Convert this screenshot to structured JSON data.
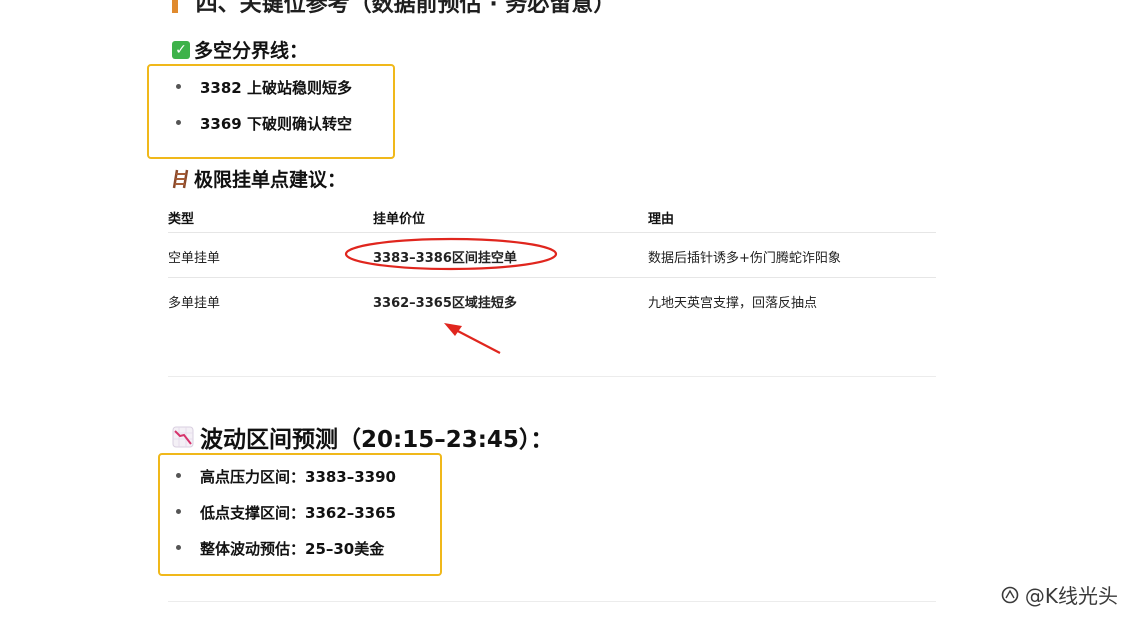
{
  "top_heading": "四、关键位参考（数据前预估 · 务必留意）",
  "section1": {
    "title": "多空分界线：",
    "items": [
      "3382 上破站稳则短多",
      "3369 下破则确认转空"
    ]
  },
  "section2": {
    "title": "极限挂单点建议：",
    "headers": [
      "类型",
      "挂单价位",
      "理由"
    ],
    "rows": [
      {
        "type": "空单挂单",
        "price": "3383–3386区间挂空单",
        "reason": "数据后插针诱多+伤门腾蛇诈阳象"
      },
      {
        "type": "多单挂单",
        "price": "3362–3365区域挂短多",
        "reason": "九地天英宫支撑，回落反抽点"
      }
    ]
  },
  "section3": {
    "title": "波动区间预测（20:15–23:45）：",
    "items": [
      "高点压力区间：3383–3390",
      "低点支撑区间：3362–3365",
      "整体波动预估：25–30美金"
    ]
  },
  "watermark": "@K线光头",
  "colors": {
    "highlight_box": "#f0b81a",
    "annotation_red": "#e0261e",
    "check_green": "#3db24a"
  },
  "icons": {
    "section1": "check-mark-icon",
    "section2": "ladder-icon",
    "section3": "chart-decreasing-icon",
    "watermark": "zhihu-logo-icon"
  }
}
